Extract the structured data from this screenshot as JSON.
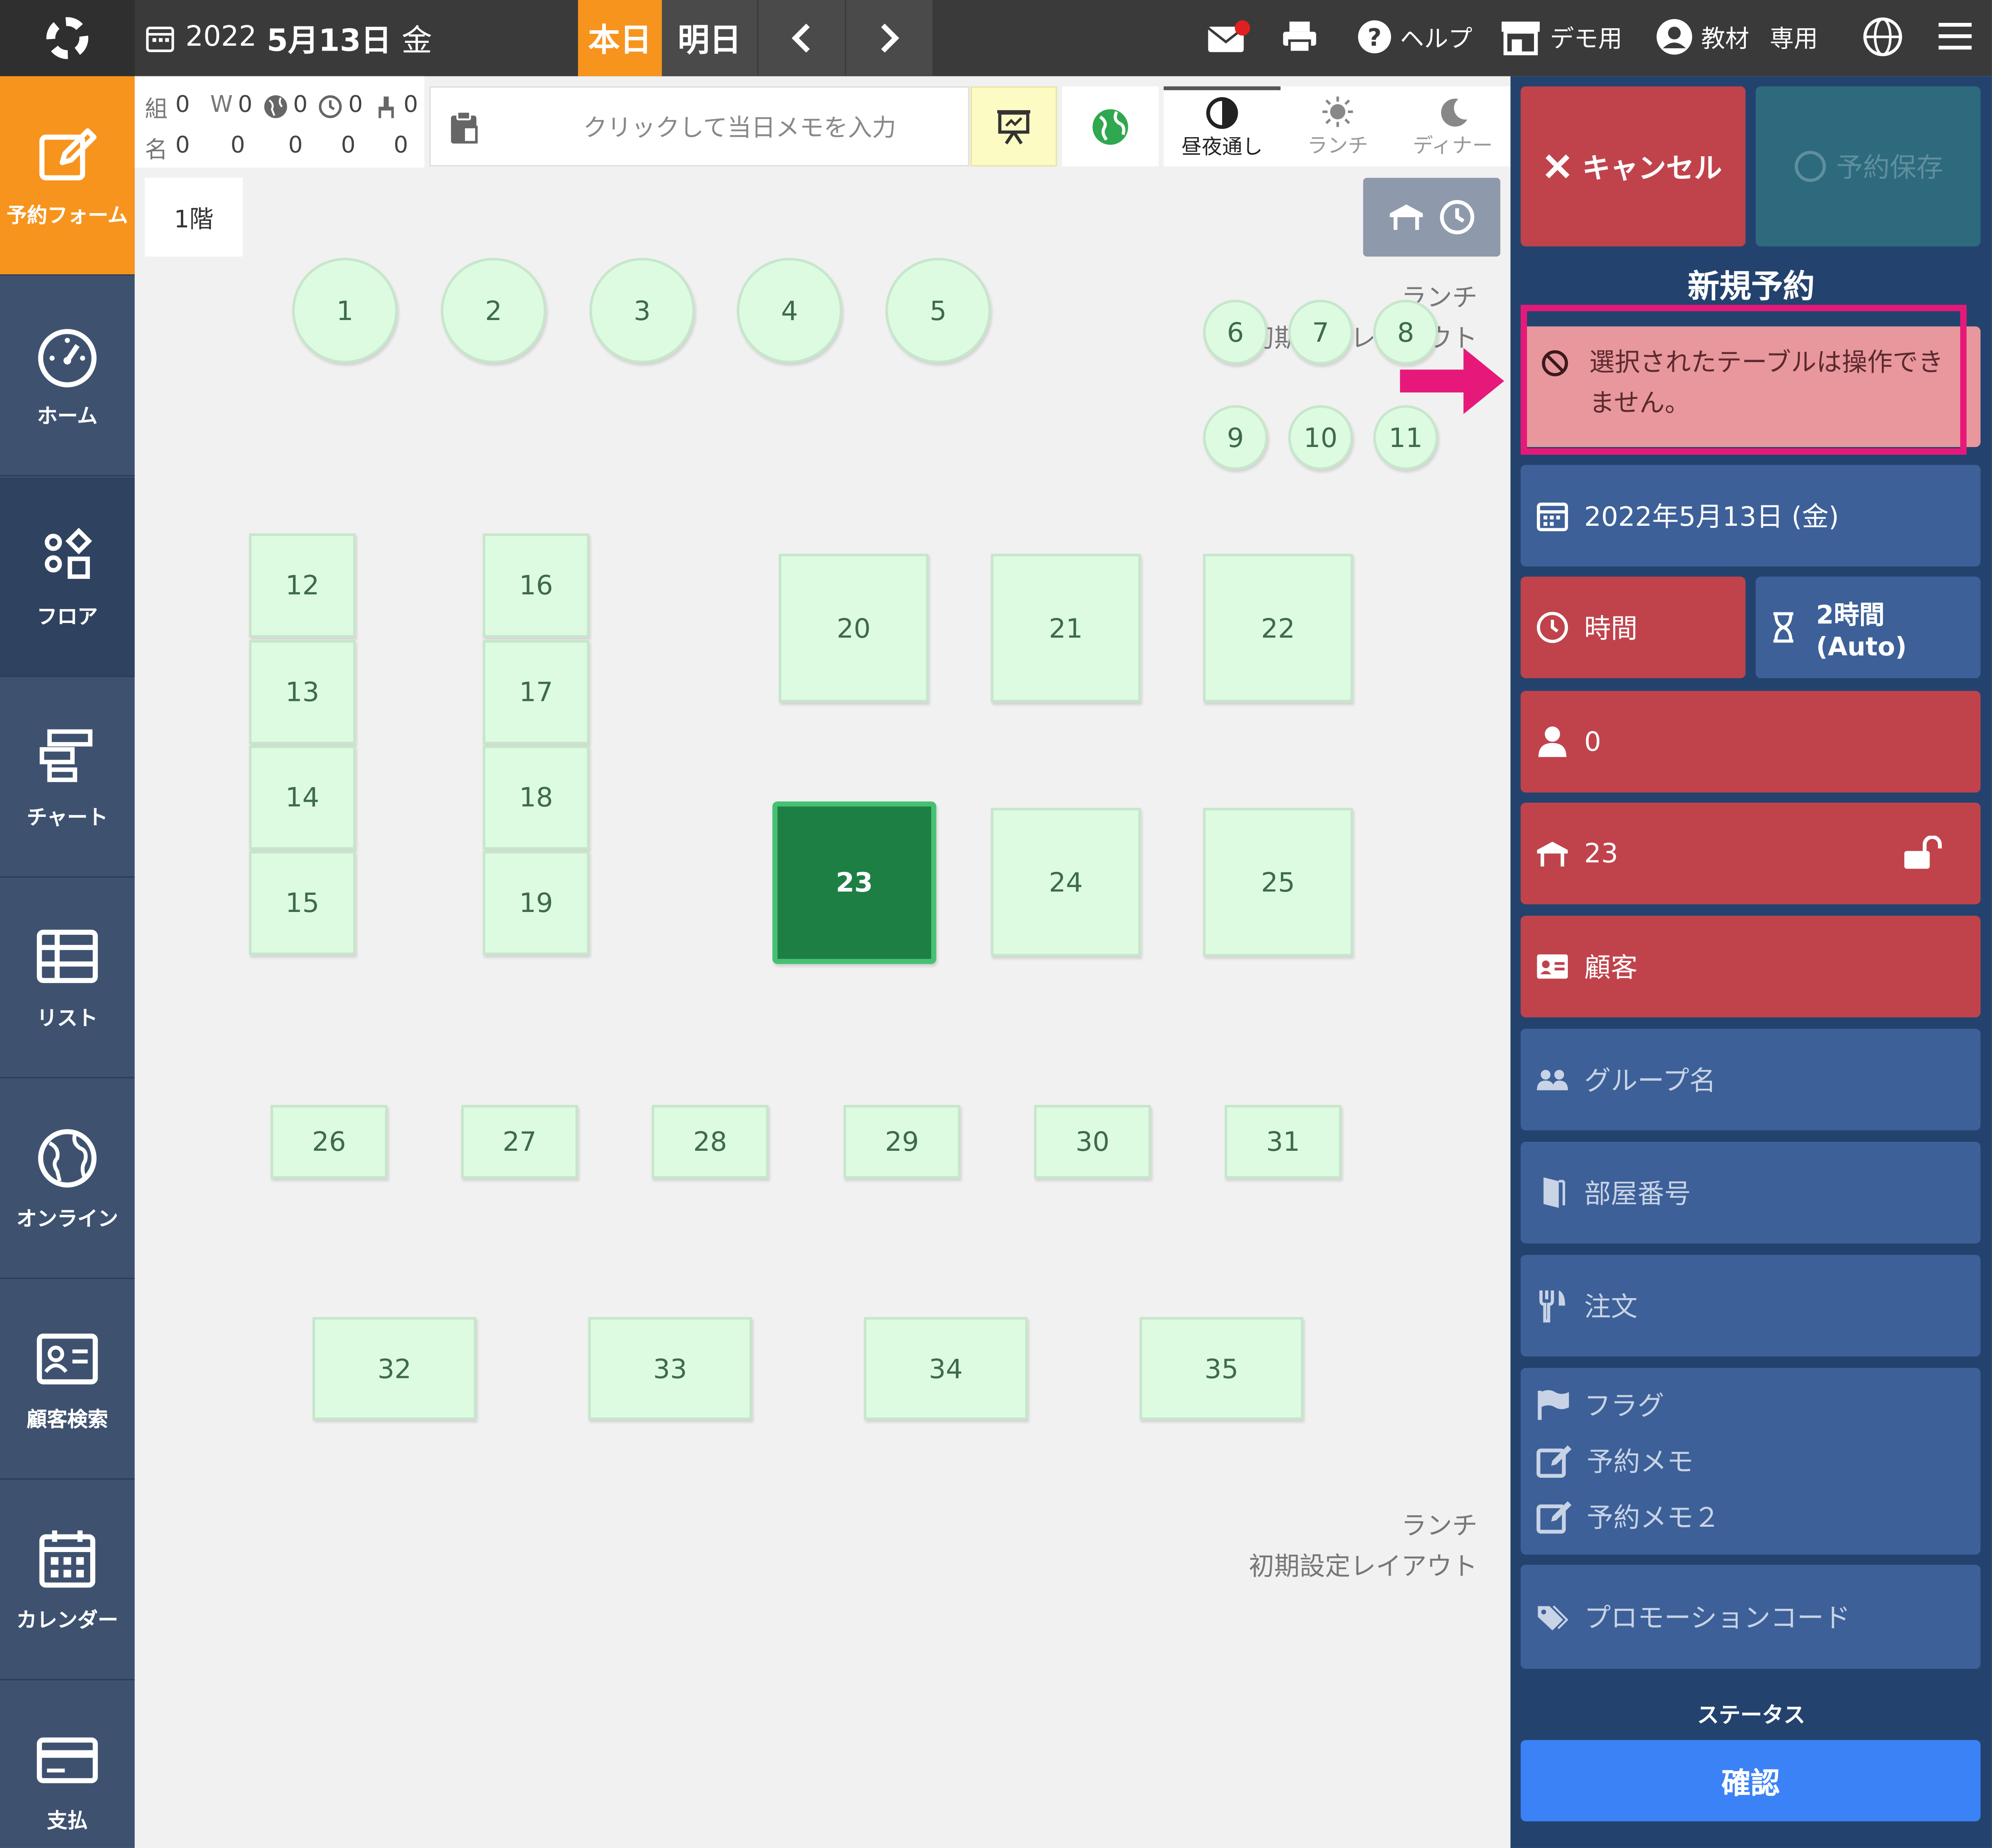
{
  "header": {
    "date_text": "2022",
    "date_main": "5月13日",
    "weekday": "金",
    "today_label": "本日",
    "tomorrow_label": "明日",
    "help_label": "ヘルプ",
    "demo_label": "デモ用",
    "user_label": "教材",
    "user_suffix": "専用",
    "mail_badge": "!"
  },
  "stats": {
    "row1": [
      "組",
      "0",
      "W",
      "0",
      "0",
      "0",
      "0"
    ],
    "row2": [
      "名",
      "0",
      "0",
      "0",
      "0",
      "0"
    ]
  },
  "memo_placeholder": "クリックして当日メモを入力",
  "modes": {
    "all": "昼夜通し",
    "lunch": "ランチ",
    "dinner": "ディナー"
  },
  "floor": {
    "tab": "1階",
    "layout_top": [
      "ランチ",
      "初期設定レイアウト"
    ],
    "layout_bottom": [
      "ランチ",
      "初期設定レイアウト"
    ],
    "tables": [
      "1",
      "2",
      "3",
      "4",
      "5",
      "6",
      "7",
      "8",
      "9",
      "10",
      "11",
      "12",
      "13",
      "14",
      "15",
      "16",
      "17",
      "18",
      "19",
      "20",
      "21",
      "22",
      "23",
      "24",
      "25",
      "26",
      "27",
      "28",
      "29",
      "30",
      "31",
      "32",
      "33",
      "34",
      "35"
    ],
    "selected_table": "23"
  },
  "nav": [
    {
      "label": "予約フォーム",
      "icon": "edit-icon"
    },
    {
      "label": "ホーム",
      "icon": "dashboard-icon"
    },
    {
      "label": "フロア",
      "icon": "floor-icon"
    },
    {
      "label": "チャート",
      "icon": "chart-icon"
    },
    {
      "label": "リスト",
      "icon": "list-icon"
    },
    {
      "label": "オンライン",
      "icon": "globe-icon"
    },
    {
      "label": "顧客検索",
      "icon": "customer-card-icon"
    },
    {
      "label": "カレンダー",
      "icon": "calendar-icon"
    },
    {
      "label": "支払",
      "icon": "credit-card-icon"
    }
  ],
  "panel": {
    "cancel_label": "キャンセル",
    "save_label": "予約保存",
    "title": "新規予約",
    "error_message": "選択されたテーブルは操作できません。",
    "date_value": "2022年5月13日 (金)",
    "time_label": "時間",
    "duration_label": "2時間 (Auto)",
    "guests_value": "0",
    "table_value": "23",
    "customer_label": "顧客",
    "group_label": "グループ名",
    "room_label": "部屋番号",
    "order_label": "注文",
    "flag_label": "フラグ",
    "memo1_label": "予約メモ",
    "memo2_label": "予約メモ２",
    "promo_label": "プロモーションコード",
    "status_heading": "ステータス",
    "status_value": "確認"
  },
  "colors": {
    "accent_orange": "#f7941d",
    "error_red": "#c0434c",
    "highlight_magenta": "#e6197a",
    "confirm_blue": "#3b82f6"
  }
}
